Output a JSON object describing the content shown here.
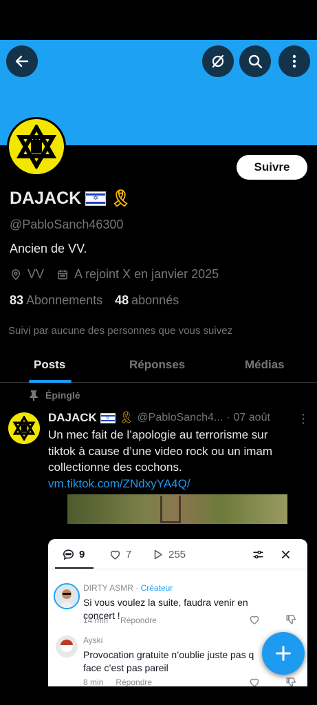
{
  "header": {
    "back_icon": "arrow-left-icon",
    "grok_icon": "grok-icon",
    "search_icon": "search-icon",
    "more_icon": "more-vertical-icon",
    "banner_color": "#1da1f2"
  },
  "profile": {
    "display_name": "DAJACK",
    "handle": "@PabloSanch46300",
    "bio": "Ancien de VV.",
    "location": "VV",
    "joined": "A rejoint X en janvier 2025",
    "following_count": "83",
    "following_label": "Abonnements",
    "followers_count": "48",
    "followers_label": "abonnés",
    "followed_by": "Suivi par aucune des personnes que vous suivez",
    "follow_label": "Suivre"
  },
  "tabs": [
    {
      "label": "Posts",
      "active": true
    },
    {
      "label": "Réponses",
      "active": false
    },
    {
      "label": "Médias",
      "active": false
    }
  ],
  "pinned_label": "Épinglé",
  "tweet": {
    "name": "DAJACK",
    "handle": "@PabloSanch4...",
    "separator": "·",
    "date": "07 août",
    "text": "Un mec fait de l’apologie au terrorisme sur tiktok à cause d’une video rock ou un imam collectionne des cochons. ",
    "link": "vm.tiktok.com/ZNdxyYA4Q/"
  },
  "tiktok": {
    "comments_count": "9",
    "likes_count": "7",
    "views_count": "255",
    "comments": [
      {
        "user": "DIRTY ASMR",
        "badge": "Créateur",
        "text": "Si vous voulez la suite, faudra venir en concert !",
        "time": "14 min",
        "reply": "Répondre"
      },
      {
        "user": "Ayski",
        "text": "Provocation gratuite n’oublie juste pas q face c’est pas pareil",
        "time": "8 min",
        "reply": "Répondre"
      }
    ]
  },
  "fab_icon": "plus-icon",
  "colors": {
    "accent": "#1d9bf0",
    "muted": "#71767b",
    "avatar_yellow": "#f3e600"
  }
}
